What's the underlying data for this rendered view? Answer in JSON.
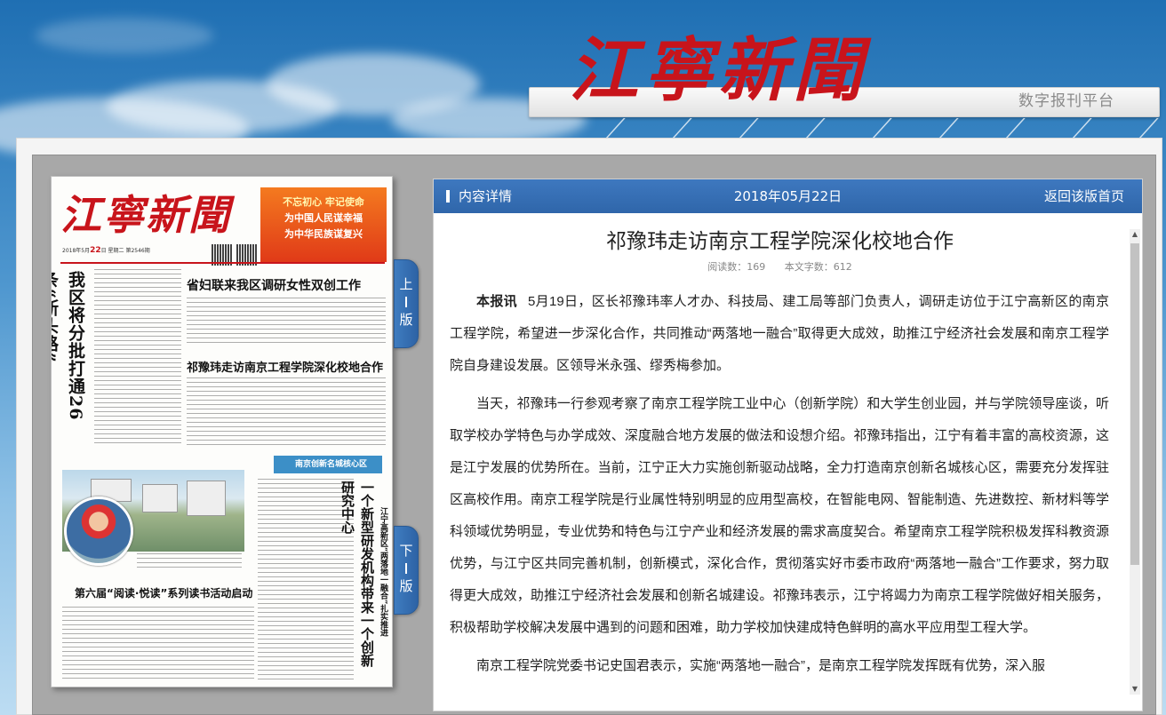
{
  "masthead": {
    "logo_text": "江寧新聞",
    "platform": "数字报刊平台"
  },
  "paper": {
    "logo_text": "江寧新聞",
    "date_big": "22",
    "dateline_prefix": "2018年5月",
    "dateline_suffix": "日  星期二  第2546期",
    "slogan": [
      "不忘初心  牢记使命",
      "为中国人民谋幸福",
      "为中华民族谋复兴"
    ],
    "headline_vertical": "我区将分批打通26条“断头路”",
    "headline_1": "省妇联来我区调研女性双创工作",
    "headline_2": "祁豫玮走访南京工程学院深化校地合作",
    "banner": "南京创新名城核心区",
    "headline_vertical_2": "一个新型研发机构带来一个创新研究中心",
    "headline_vertical_3": "江宁高新区“两落地一融合”扎实推进",
    "headline_3": "第六届“阅读·悦读”系列读书活动启动"
  },
  "nav": {
    "prev_1": "上",
    "prev_2": "版",
    "next_1": "下",
    "next_2": "版"
  },
  "panel": {
    "section_label": "内容详情",
    "date": "2018年05月22日",
    "back_link": "返回该版首页"
  },
  "article": {
    "title": "祁豫玮走访南京工程学院深化校地合作",
    "read_count": "阅读数：169",
    "word_count": "本文字数：612",
    "lead": "本报讯",
    "paragraphs": [
      "5月19日，区长祁豫玮率人才办、科技局、建工局等部门负责人，调研走访位于江宁高新区的南京工程学院，希望进一步深化合作，共同推动“两落地一融合”取得更大成效，助推江宁经济社会发展和南京工程学院自身建设发展。区领导米永强、缪秀梅参加。",
      "当天，祁豫玮一行参观考察了南京工程学院工业中心（创新学院）和大学生创业园，并与学院领导座谈，听取学校办学特色与办学成效、深度融合地方发展的做法和设想介绍。祁豫玮指出，江宁有着丰富的高校资源，这是江宁发展的优势所在。当前，江宁正大力实施创新驱动战略，全力打造南京创新名城核心区，需要充分发挥驻区高校作用。南京工程学院是行业属性特别明显的应用型高校，在智能电网、智能制造、先进数控、新材料等学科领域优势明显，专业优势和特色与江宁产业和经济发展的需求高度契合。希望南京工程学院积极发挥科教资源优势，与江宁区共同完善机制，创新模式，深化合作，贯彻落实好市委市政府“两落地一融合”工作要求，努力取得更大成效，助推江宁经济社会发展和创新名城建设。祁豫玮表示，江宁将竭力为南京工程学院做好相关服务，积极帮助学校解决发展中遇到的问题和困难，助力学校加快建成特色鲜明的高水平应用型工程大学。",
      "南京工程学院党委书记史国君表示，实施“两落地一融合”，是南京工程学院发挥既有优势，深入服"
    ]
  },
  "scroll": {
    "up_icon": "▲",
    "down_icon": "▼"
  }
}
